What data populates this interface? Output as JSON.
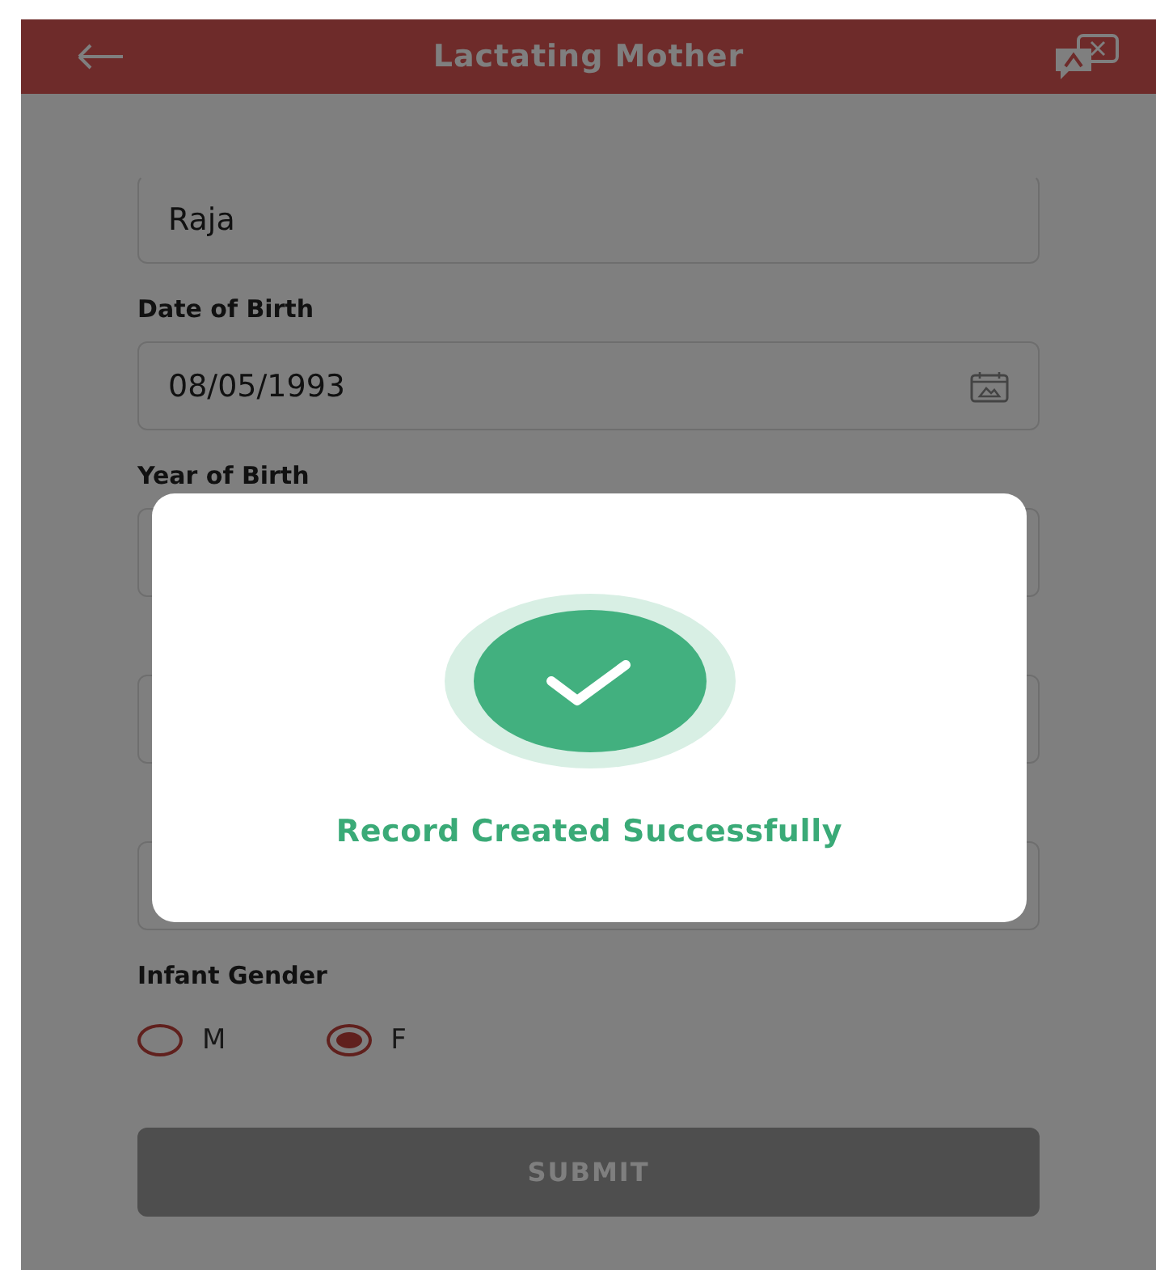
{
  "header": {
    "title": "Lactating Mother"
  },
  "form": {
    "fields": [
      {
        "kind": "text",
        "value": "Raja"
      },
      {
        "kind": "date",
        "label": "Date of Birth",
        "value": "08/05/1993"
      },
      {
        "kind": "text",
        "label": "Year of Birth"
      },
      {
        "kind": "text"
      },
      {
        "kind": "text"
      }
    ],
    "gender": {
      "label": "Infant Gender",
      "options": [
        {
          "label": "M",
          "selected": false
        },
        {
          "label": "F",
          "selected": true
        }
      ]
    },
    "submit_button": {
      "label": "SUBMIT",
      "disabled": true
    }
  },
  "dialog": {
    "message": "Record Created Successfully"
  }
}
